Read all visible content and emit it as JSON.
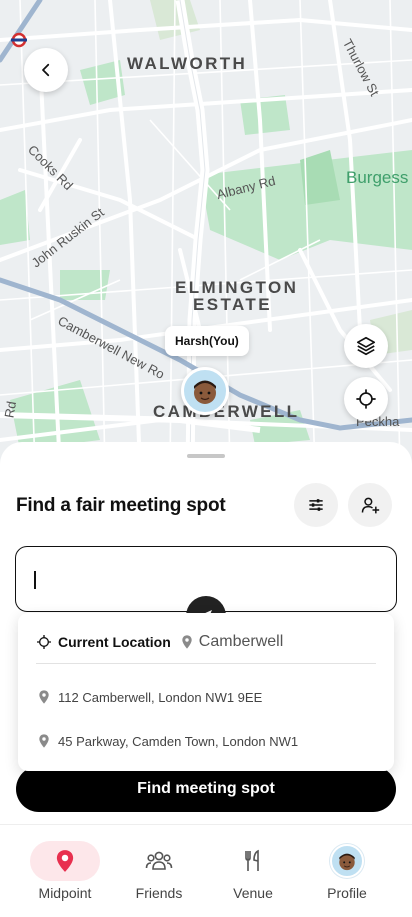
{
  "map": {
    "areas": [
      "WALWORTH",
      "ELMINGTON",
      "ESTATE",
      "CAMBERWELL"
    ],
    "streets": [
      "Thurlow St",
      "Cooks Rd",
      "John Ruskin St",
      "Albany Rd",
      "Camberwell New Ro",
      "Peckha",
      "Rd"
    ],
    "green_label": "Burgess",
    "you_label": "Harsh(You)",
    "colors": {
      "park": "#bfe6c9",
      "road": "#ffffff",
      "highway": "#9fb5cf",
      "background": "#eceff1"
    }
  },
  "buttons": {
    "back_icon": "chevron-left-icon",
    "layers_icon": "layers-icon",
    "locate_icon": "crosshair-icon"
  },
  "sheet": {
    "title": "Find a fair meeting spot",
    "filter_icon": "sliders-icon",
    "add_person_icon": "user-plus-icon",
    "search_value": "",
    "suggestions": {
      "current_location_label": "Current Location",
      "current_city": "Camberwell",
      "addresses": [
        "112 Camberwell, London NW1 9EE",
        "45 Parkway, Camden Town, London NW1"
      ]
    },
    "cta_label": "Find meeting spot",
    "accent": "#000000"
  },
  "nav": {
    "items": [
      {
        "label": "Midpoint",
        "icon": "map-pin-icon",
        "active": true
      },
      {
        "label": "Friends",
        "icon": "people-icon",
        "active": false
      },
      {
        "label": "Venue",
        "icon": "fork-knife-icon",
        "active": false
      },
      {
        "label": "Profile",
        "icon": "avatar-icon",
        "active": false
      }
    ],
    "active_color": "#e8304f"
  }
}
